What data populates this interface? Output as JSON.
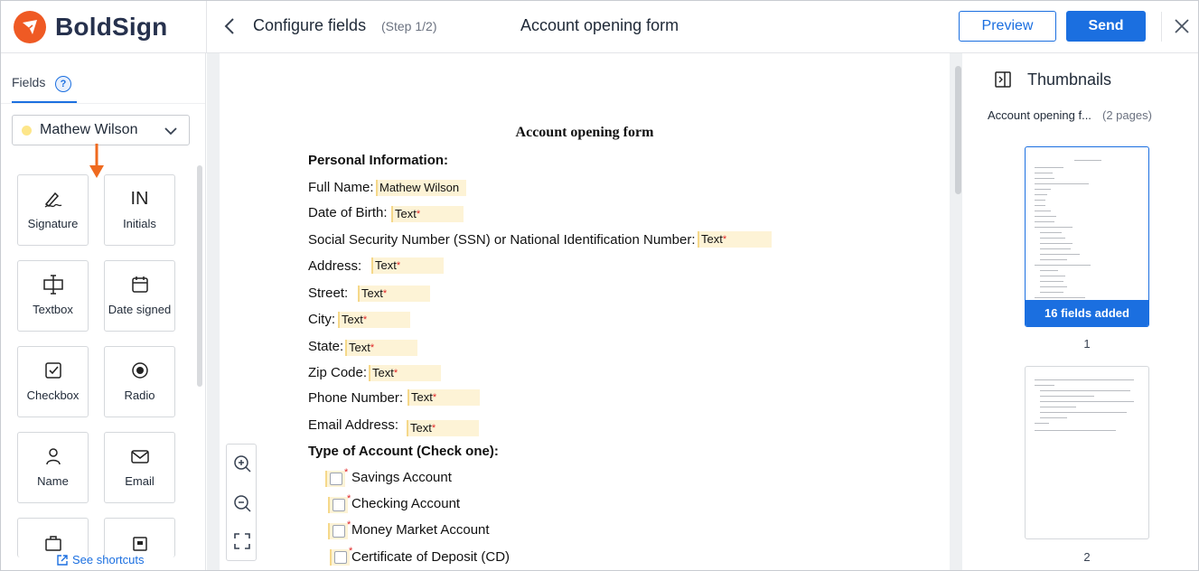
{
  "app": {
    "name": "BoldSign"
  },
  "header": {
    "title": "Configure fields",
    "step": "(Step 1/2)",
    "document_title": "Account opening form",
    "preview_label": "Preview",
    "send_label": "Send"
  },
  "sidebar": {
    "tab_label": "Fields",
    "help_label": "?",
    "signer": "Mathew Wilson",
    "fields": [
      {
        "label": "Signature",
        "icon": "signature-icon"
      },
      {
        "label": "Initials",
        "icon": "initials-icon",
        "glyph": "IN"
      },
      {
        "label": "Textbox",
        "icon": "textbox-icon"
      },
      {
        "label": "Date signed",
        "icon": "calendar-icon"
      },
      {
        "label": "Checkbox",
        "icon": "checkbox-icon"
      },
      {
        "label": "Radio",
        "icon": "radio-icon"
      },
      {
        "label": "Name",
        "icon": "person-icon"
      },
      {
        "label": "Email",
        "icon": "envelope-icon"
      }
    ],
    "shortcuts_label": "See shortcuts"
  },
  "document": {
    "heading": "Account opening form",
    "section_personal": "Personal Information:",
    "rows": [
      {
        "label": "Full Name:",
        "value": "Mathew Wilson",
        "required": false
      },
      {
        "label": "Date of Birth:",
        "value": "Text",
        "required": true
      },
      {
        "label": "Social Security Number (SSN) or National Identification Number:",
        "value": "Text",
        "required": true
      },
      {
        "label": "Address:",
        "value": "Text",
        "required": true
      },
      {
        "label": "Street:",
        "value": "Text",
        "required": true
      },
      {
        "label": "City:",
        "value": "Text",
        "required": true
      },
      {
        "label": "State:",
        "value": "Text",
        "required": true
      },
      {
        "label": "Zip Code:",
        "value": "Text",
        "required": true
      },
      {
        "label": "Phone Number:",
        "value": "Text",
        "required": true
      },
      {
        "label": "Email Address:",
        "value": "Text",
        "required": true
      }
    ],
    "section_account": "Type of Account (Check one):",
    "account_types": [
      "Savings Account",
      "Checking Account",
      "Money Market Account",
      "Certificate of Deposit (CD)"
    ],
    "required_mark": "*"
  },
  "thumbnails": {
    "title": "Thumbnails",
    "doc_name": "Account opening f...",
    "page_count": "(2 pages)",
    "pages": [
      {
        "number": "1",
        "badge": "16 fields added"
      },
      {
        "number": "2"
      }
    ]
  },
  "colors": {
    "accent": "#1b6fe0",
    "brand": "#ef5a24",
    "field_fill": "#fdf3d6"
  }
}
